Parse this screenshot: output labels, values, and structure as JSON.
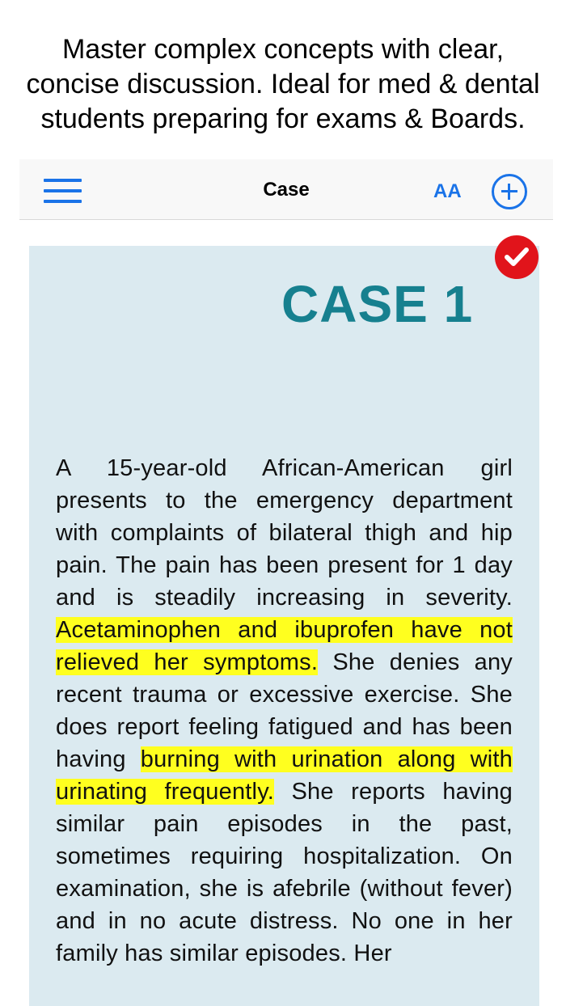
{
  "promo": {
    "line1": "Master complex concepts with clear,",
    "line2": "concise discussion. Ideal for med & dental",
    "line3": "students preparing for exams & Boards."
  },
  "navbar": {
    "title": "Case",
    "text_size_label": "AA",
    "menu_icon": "hamburger-menu-icon",
    "add_icon": "plus-circle-icon"
  },
  "case": {
    "heading": "CASE 1",
    "status_icon": "checkmark-icon",
    "paragraph": [
      {
        "text": "A 15-year-old African-American girl presents to the emergency department with complaints of bilateral thigh and hip pain. The pain has been present for 1 day and is steadily increasing in severity. ",
        "highlight": false
      },
      {
        "text": "Acetaminophen and ibuprofen have not relieved her symptoms.",
        "highlight": true
      },
      {
        "text": " She denies any recent trauma or excessive exercise. She does report feeling fatigued and has been having ",
        "highlight": false
      },
      {
        "text": "burning with urination along with urinating frequently.",
        "highlight": true
      },
      {
        "text": " She reports having similar pain episodes in the past, sometimes requiring hospitalization. On examination, she is afebrile (without fever) and in no acute distress. No one in her family has similar episodes. Her",
        "highlight": false
      }
    ]
  },
  "colors": {
    "accent": "#1a73e8",
    "heading": "#16808f",
    "panel_bg": "#dbeaf0",
    "highlight": "#ffff1f",
    "badge": "#e1141b"
  }
}
